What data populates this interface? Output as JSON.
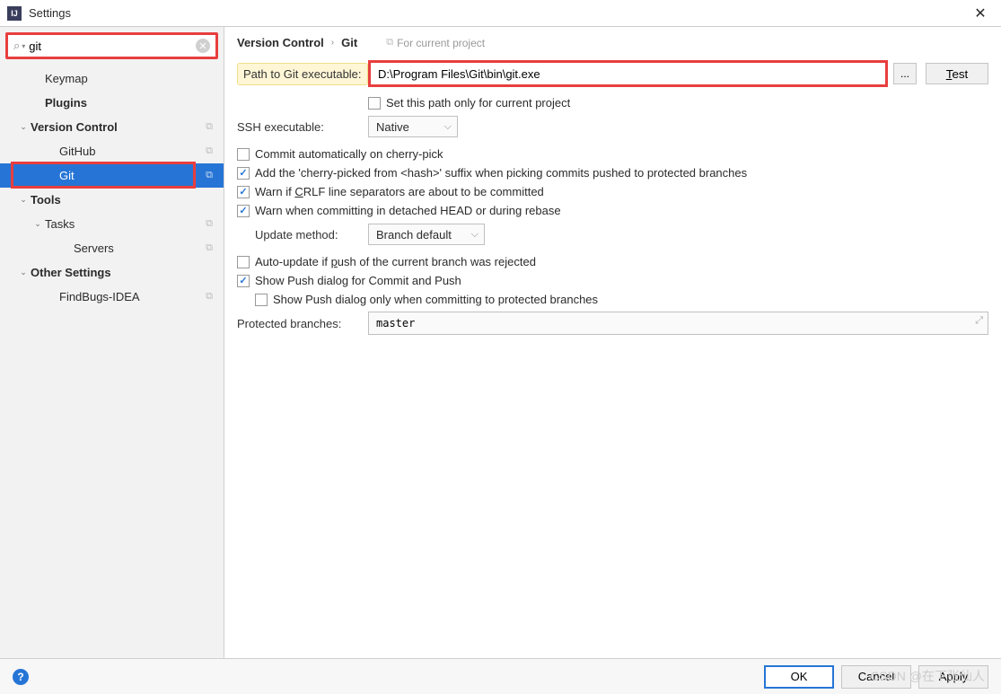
{
  "window": {
    "title": "Settings"
  },
  "search": {
    "value": "git"
  },
  "sidebar": {
    "items": [
      {
        "label": "Keymap",
        "bold": false,
        "indent": 2,
        "chev": "",
        "copy": false
      },
      {
        "label": "Plugins",
        "bold": true,
        "indent": 2,
        "chev": "",
        "copy": false
      },
      {
        "label": "Version Control",
        "bold": true,
        "indent": 1,
        "chev": "v",
        "copy": true
      },
      {
        "label": "GitHub",
        "bold": false,
        "indent": 3,
        "chev": "",
        "copy": true
      },
      {
        "label": "Git",
        "bold": false,
        "indent": 3,
        "chev": "",
        "copy": true,
        "selected": true,
        "highlight": true
      },
      {
        "label": "Tools",
        "bold": true,
        "indent": 1,
        "chev": "v",
        "copy": false
      },
      {
        "label": "Tasks",
        "bold": false,
        "indent": 2,
        "chev": "v",
        "copy": true
      },
      {
        "label": "Servers",
        "bold": false,
        "indent": 4,
        "chev": "",
        "copy": true
      },
      {
        "label": "Other Settings",
        "bold": true,
        "indent": 1,
        "chev": "v",
        "copy": false
      },
      {
        "label": "FindBugs-IDEA",
        "bold": false,
        "indent": 3,
        "chev": "",
        "copy": true
      }
    ]
  },
  "breadcrumb": {
    "parent": "Version Control",
    "current": "Git",
    "scope": "For current project"
  },
  "form": {
    "path_label": "Path to Git executable:",
    "path_value": "D:\\Program Files\\Git\\bin\\git.exe",
    "browse": "...",
    "test_u": "T",
    "test_rest": "est",
    "set_path_project": "Set this path only for current project",
    "ssh_label": "SSH executable:",
    "ssh_value": "Native",
    "cb_cherry_auto": "Commit automatically on cherry-pick",
    "cb_cherry_suffix": "Add the 'cherry-picked from <hash>' suffix when picking commits pushed to protected branches",
    "cb_crlf_pre": "Warn if ",
    "cb_crlf_u": "C",
    "cb_crlf_post": "RLF line separators are about to be committed",
    "cb_detached": "Warn when committing in detached HEAD or during rebase",
    "update_label": "Update method:",
    "update_value": "Branch default",
    "cb_autoupdate_pre": "Auto-update if ",
    "cb_autoupdate_u": "p",
    "cb_autoupdate_post": "ush of the current branch was rejected",
    "cb_showpush": "Show Push dialog for Commit and Push",
    "cb_showpush_protected": "Show Push dialog only when committing to protected branches",
    "protected_label": "Protected branches:",
    "protected_value": "master"
  },
  "footer": {
    "ok": "OK",
    "cancel": "Cancel",
    "apply": "Apply"
  },
  "watermark": "CSDN @在下张仙人"
}
